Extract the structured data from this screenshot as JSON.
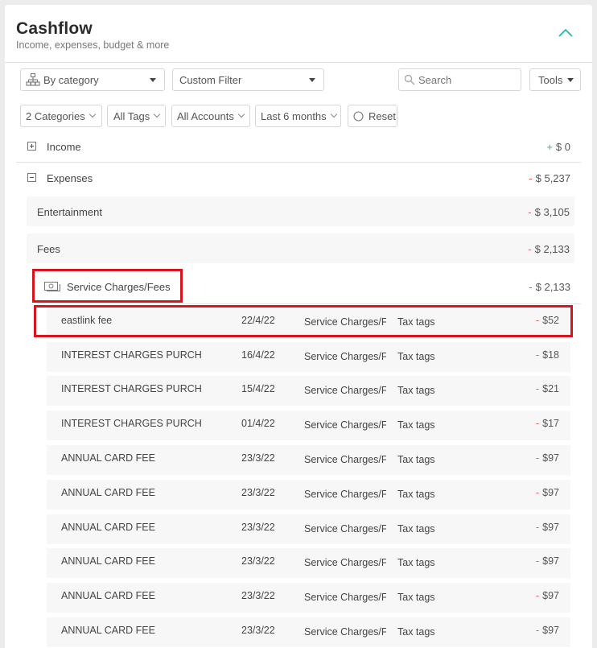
{
  "header": {
    "title": "Cashflow",
    "subtitle": "Income, expenses, budget & more"
  },
  "toolbar": {
    "group_by": "By category",
    "filter": "Custom Filter",
    "search_placeholder": "Search",
    "tools": "Tools"
  },
  "filters": {
    "categories": "2 Categories",
    "tags": "All Tags",
    "accounts": "All Accounts",
    "period": "Last 6 months",
    "reset": "Reset"
  },
  "income": {
    "label": "Income",
    "sign": "+",
    "amount": "$ 0"
  },
  "expenses": {
    "label": "Expenses",
    "sign": "-",
    "amount": "$ 5,237"
  },
  "groups": {
    "entertainment": {
      "label": "Entertainment",
      "sign": "-",
      "amount": "$ 3,105"
    },
    "fees": {
      "label": "Fees",
      "sign": "-",
      "amount": "$ 2,133"
    },
    "service": {
      "label": "Service Charges/Fees",
      "sign": "-",
      "amount": "$ 2,133"
    }
  },
  "transactions": [
    {
      "name": "eastlink fee",
      "date": "22/4/22",
      "category": "Service Charges/Fees",
      "tags": "Tax tags",
      "sign": "-",
      "amount": "$52"
    },
    {
      "name": "INTEREST CHARGES PURCH",
      "date": "16/4/22",
      "category": "Service Charges/Fees",
      "tags": "Tax tags",
      "sign": "-",
      "amount": "$18"
    },
    {
      "name": "INTEREST CHARGES PURCH",
      "date": "15/4/22",
      "category": "Service Charges/Fees",
      "tags": "Tax tags",
      "sign": "-",
      "amount": "$21"
    },
    {
      "name": "INTEREST CHARGES PURCH",
      "date": "01/4/22",
      "category": "Service Charges/Fees",
      "tags": "Tax tags",
      "sign": "-",
      "amount": "$17"
    },
    {
      "name": "ANNUAL CARD FEE",
      "date": "23/3/22",
      "category": "Service Charges/Fees",
      "tags": "Tax tags",
      "sign": "-",
      "amount": "$97"
    },
    {
      "name": "ANNUAL CARD FEE",
      "date": "23/3/22",
      "category": "Service Charges/Fees",
      "tags": "Tax tags",
      "sign": "-",
      "amount": "$97"
    },
    {
      "name": "ANNUAL CARD FEE",
      "date": "23/3/22",
      "category": "Service Charges/Fees",
      "tags": "Tax tags",
      "sign": "-",
      "amount": "$97"
    },
    {
      "name": "ANNUAL CARD FEE",
      "date": "23/3/22",
      "category": "Service Charges/Fees",
      "tags": "Tax tags",
      "sign": "-",
      "amount": "$97"
    },
    {
      "name": "ANNUAL CARD FEE",
      "date": "23/3/22",
      "category": "Service Charges/Fees",
      "tags": "Tax tags",
      "sign": "-",
      "amount": "$97"
    },
    {
      "name": "ANNUAL CARD FEE",
      "date": "23/3/22",
      "category": "Service Charges/Fees",
      "tags": "Tax tags",
      "sign": "-",
      "amount": "$97"
    }
  ],
  "colors": {
    "negative": "#e0585f",
    "positive": "#58a878",
    "accent": "#3dbdb0",
    "highlight": "#d8141c"
  }
}
